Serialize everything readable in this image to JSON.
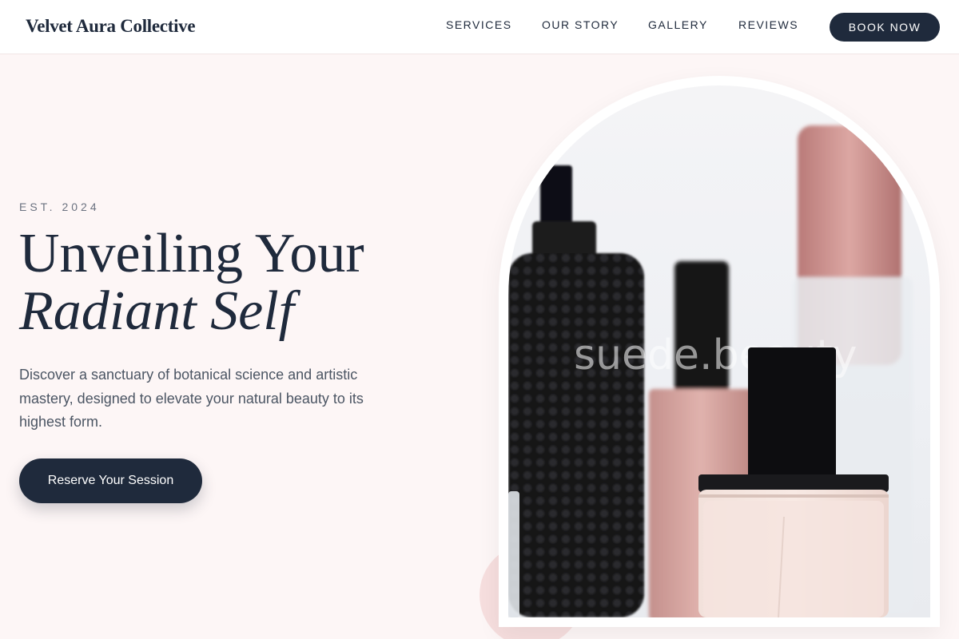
{
  "brand": {
    "name": "Velvet Aura Collective"
  },
  "nav": {
    "links": [
      "SERVICES",
      "OUR STORY",
      "GALLERY",
      "REVIEWS"
    ],
    "cta_label": "BOOK NOW"
  },
  "hero": {
    "eyebrow": "EST. 2024",
    "title_line1": "Unveiling Your",
    "title_line2": "Radiant Self",
    "description": "Discover a sanctuary of botanical science and artistic mastery, designed to elevate your natural beauty to its highest form.",
    "cta_label": "Reserve Your Session",
    "image_watermark": "suede.beauty"
  },
  "colors": {
    "navy": "#1f2a3c",
    "background_blush": "#fdf6f6",
    "accent_rose": "#c98f8f"
  }
}
